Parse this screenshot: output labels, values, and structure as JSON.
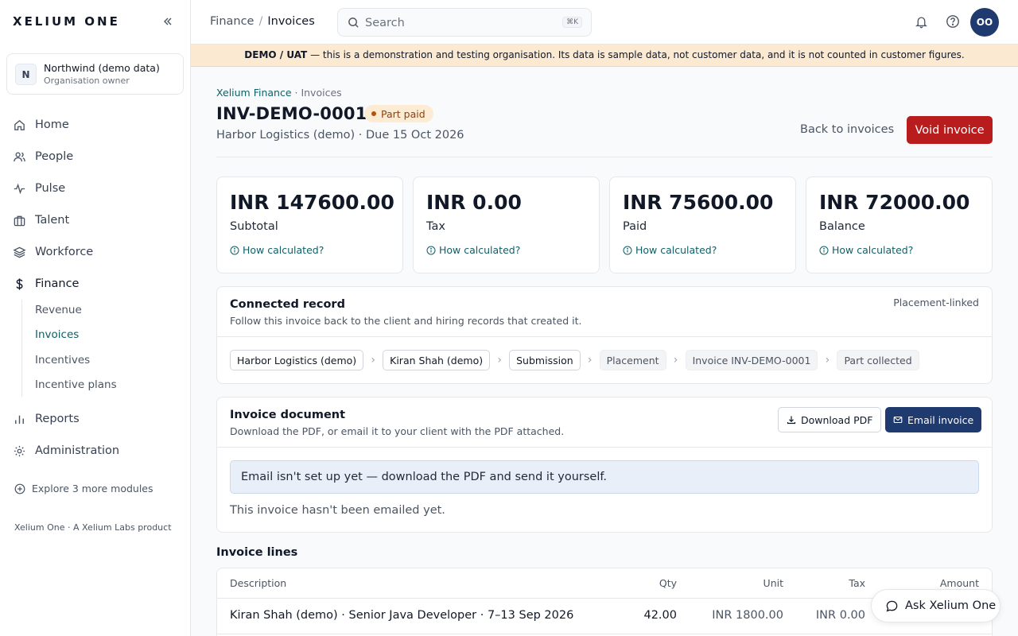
{
  "brand": "XELIUM ONE",
  "org": {
    "initial": "N",
    "name": "Northwind (demo data)",
    "role": "Organisation owner"
  },
  "nav": {
    "home": "Home",
    "people": "People",
    "pulse": "Pulse",
    "talent": "Talent",
    "workforce": "Workforce",
    "finance": "Finance",
    "finance_sub": [
      "Revenue",
      "Invoices",
      "Incentives",
      "Incentive plans"
    ],
    "reports": "Reports",
    "administration": "Administration"
  },
  "explore": "Explore 3 more modules",
  "footer": "Xelium One · A Xelium Labs product",
  "topbar": {
    "crumb_parent": "Finance",
    "crumb_sep": "/",
    "crumb_current": "Invoices",
    "search_placeholder": "Search",
    "search_kbd": "⌘K",
    "user_initials": "OO"
  },
  "banner": {
    "label": "DEMO / UAT",
    "text": " — this is a demonstration and testing organisation. Its data is sample data, not customer data, and it is not counted in customer figures."
  },
  "page": {
    "crumb_parent": "Xelium Finance",
    "crumb_sep": " · ",
    "crumb_current": "Invoices",
    "title": "INV-DEMO-0001",
    "status": "Part paid",
    "subtitle": "Harbor Logistics (demo) · Due 15 Oct 2026",
    "back_label": "Back to invoices",
    "void_label": "Void invoice"
  },
  "stats": [
    {
      "value": "INR 147600.00",
      "label": "Subtotal",
      "link": "How calculated?"
    },
    {
      "value": "INR 0.00",
      "label": "Tax",
      "link": "How calculated?"
    },
    {
      "value": "INR 75600.00",
      "label": "Paid",
      "link": "How calculated?"
    },
    {
      "value": "INR 72000.00",
      "label": "Balance",
      "link": "How calculated?"
    }
  ],
  "connected": {
    "title": "Connected record",
    "desc": "Follow this invoice back to the client and hiring records that created it.",
    "tag": "Placement-linked",
    "chain": [
      "Harbor Logistics (demo)",
      "Kiran Shah (demo)",
      "Submission",
      "Placement",
      "Invoice INV-DEMO-0001",
      "Part collected"
    ]
  },
  "document": {
    "title": "Invoice document",
    "desc": "Download the PDF, or email it to your client with the PDF attached.",
    "download_label": "Download PDF",
    "email_label": "Email invoice",
    "notice": "Email isn't set up yet — download the PDF and send it yourself.",
    "status": "This invoice hasn't been emailed yet."
  },
  "lines": {
    "title": "Invoice lines",
    "headers": {
      "description": "Description",
      "qty": "Qty",
      "unit": "Unit",
      "tax": "Tax",
      "amount": "Amount"
    },
    "rows": [
      {
        "description": "Kiran Shah (demo) · Senior Java Developer · 7–13 Sep 2026",
        "qty": "42.00",
        "unit": "INR 1800.00",
        "tax": "INR 0.00"
      }
    ]
  },
  "ask": "Ask Xelium One",
  "colors": {
    "accent_teal": "#0f5f66",
    "primary_navy": "#1e3a6e",
    "danger": "#b91c1c",
    "banner_bg": "#fbe9d2"
  }
}
